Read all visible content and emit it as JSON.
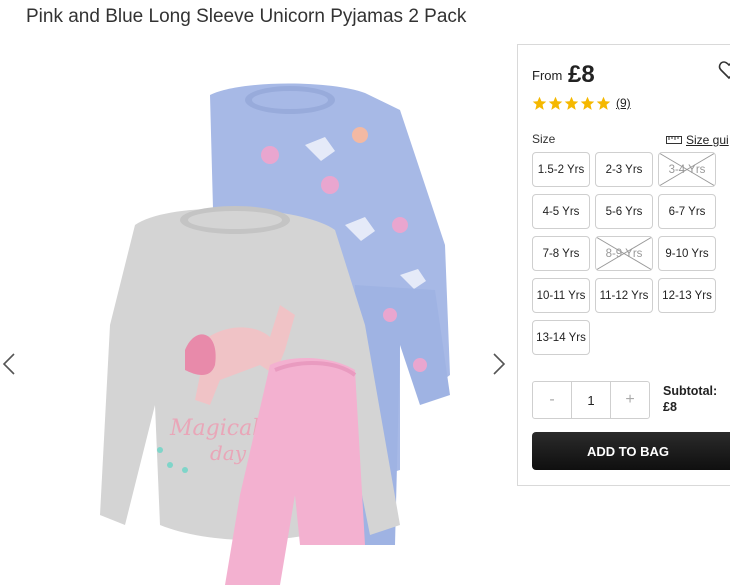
{
  "product": {
    "title": "Pink and Blue Long Sleeve Unicorn Pyjamas 2 Pack"
  },
  "price": {
    "from_label": "From",
    "value": "£8"
  },
  "rating": {
    "stars": 5,
    "count": "(9)",
    "star_color": "#f5b800"
  },
  "size": {
    "label": "Size",
    "guide_label": "Size gui",
    "options": [
      {
        "label": "1.5-2 Yrs",
        "available": true
      },
      {
        "label": "2-3 Yrs",
        "available": true
      },
      {
        "label": "3-4 Yrs",
        "available": false
      },
      {
        "label": "4-5 Yrs",
        "available": true
      },
      {
        "label": "5-6 Yrs",
        "available": true
      },
      {
        "label": "6-7 Yrs",
        "available": true
      },
      {
        "label": "7-8 Yrs",
        "available": true
      },
      {
        "label": "8-9 Yrs",
        "available": false
      },
      {
        "label": "9-10 Yrs",
        "available": true
      },
      {
        "label": "10-11 Yrs",
        "available": true
      },
      {
        "label": "11-12 Yrs",
        "available": true
      },
      {
        "label": "12-13 Yrs",
        "available": true
      },
      {
        "label": "13-14 Yrs",
        "available": true
      }
    ]
  },
  "quantity": {
    "minus": "-",
    "value": "1",
    "plus": "+"
  },
  "subtotal": {
    "label": "Subtotal:",
    "value": "£8"
  },
  "actions": {
    "add_to_bag": "ADD TO BAG"
  },
  "icons": {
    "prev": "chevron-left-icon",
    "next": "chevron-right-icon",
    "wishlist": "heart-icon",
    "size_guide": "ruler-icon"
  }
}
